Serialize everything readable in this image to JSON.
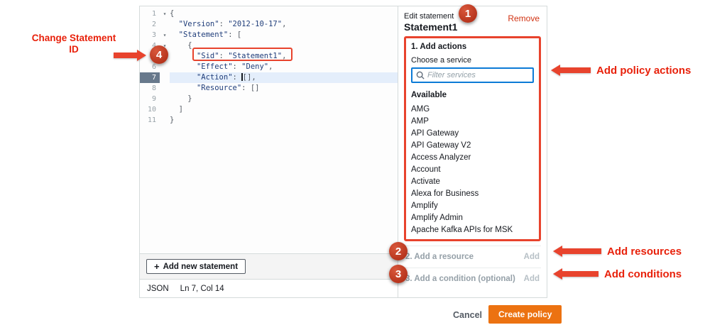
{
  "editor": {
    "lines": [
      {
        "num": "1",
        "fold": true,
        "parts": [
          {
            "t": "p",
            "x": "{"
          }
        ]
      },
      {
        "num": "2",
        "parts": [
          {
            "t": "p",
            "x": "  "
          },
          {
            "t": "k",
            "x": "\"Version\""
          },
          {
            "t": "p",
            "x": ": "
          },
          {
            "t": "s",
            "x": "\"2012-10-17\""
          },
          {
            "t": "p",
            "x": ","
          }
        ]
      },
      {
        "num": "3",
        "fold": true,
        "parts": [
          {
            "t": "p",
            "x": "  "
          },
          {
            "t": "k",
            "x": "\"Statement\""
          },
          {
            "t": "p",
            "x": ": ["
          }
        ]
      },
      {
        "num": "4",
        "fold": true,
        "parts": [
          {
            "t": "p",
            "x": "    "
          },
          {
            "t": "p",
            "x": "{"
          }
        ]
      },
      {
        "num": "5",
        "parts": [
          {
            "t": "p",
            "x": "      "
          },
          {
            "t": "k",
            "x": "\"Sid\""
          },
          {
            "t": "p",
            "x": ": "
          },
          {
            "t": "s",
            "x": "\"Statement1\""
          },
          {
            "t": "p",
            "x": ","
          }
        ]
      },
      {
        "num": "6",
        "parts": [
          {
            "t": "p",
            "x": "      "
          },
          {
            "t": "k",
            "x": "\"Effect\""
          },
          {
            "t": "p",
            "x": ": "
          },
          {
            "t": "s",
            "x": "\"Deny\""
          },
          {
            "t": "p",
            "x": ","
          }
        ]
      },
      {
        "num": "7",
        "active": true,
        "parts": [
          {
            "t": "p",
            "x": "      "
          },
          {
            "t": "k",
            "x": "\"Action\""
          },
          {
            "t": "p",
            "x": ": "
          },
          {
            "t": "cur",
            "x": ""
          },
          {
            "t": "p",
            "x": "[],"
          }
        ]
      },
      {
        "num": "8",
        "parts": [
          {
            "t": "p",
            "x": "      "
          },
          {
            "t": "k",
            "x": "\"Resource\""
          },
          {
            "t": "p",
            "x": ": "
          },
          {
            "t": "p",
            "x": "[]"
          }
        ]
      },
      {
        "num": "9",
        "parts": [
          {
            "t": "p",
            "x": "    "
          },
          {
            "t": "p",
            "x": "}"
          }
        ]
      },
      {
        "num": "10",
        "parts": [
          {
            "t": "p",
            "x": "  "
          },
          {
            "t": "p",
            "x": "]"
          }
        ]
      },
      {
        "num": "11",
        "parts": [
          {
            "t": "p",
            "x": "}"
          }
        ]
      }
    ],
    "add_statement_label": "Add new statement",
    "plus_icon": "+",
    "status": {
      "mode": "JSON",
      "cursor_position": "Ln 7, Col 14"
    }
  },
  "panel": {
    "header": {
      "eyebrow": "Edit statement",
      "title": "Statement1",
      "remove_label": "Remove"
    },
    "actions_section": {
      "title": "1. Add actions",
      "choose_label": "Choose a service",
      "filter_placeholder": "Filter services",
      "available_label": "Available",
      "services": [
        "AMG",
        "AMP",
        "API Gateway",
        "API Gateway V2",
        "Access Analyzer",
        "Account",
        "Activate",
        "Alexa for Business",
        "Amplify",
        "Amplify Admin",
        "Apache Kafka APIs for MSK"
      ]
    },
    "resource_row": {
      "label": "2. Add a resource",
      "button": "Add"
    },
    "condition_row": {
      "label": "3. Add a condition (optional)",
      "button": "Add"
    }
  },
  "footer": {
    "cancel_label": "Cancel",
    "create_label": "Create policy"
  },
  "annotations": {
    "change_statement_id": "Change Statement ID",
    "add_policy_actions": "Add policy actions",
    "add_resources": "Add resources",
    "add_conditions": "Add conditions",
    "badge_1": "1",
    "badge_2": "2",
    "badge_3": "3",
    "badge_4": "4"
  },
  "colors": {
    "annotation_red": "#e8432d",
    "aws_orange": "#ec7211",
    "remove_red": "#d13212",
    "input_focus_blue": "#0c7bd6"
  }
}
